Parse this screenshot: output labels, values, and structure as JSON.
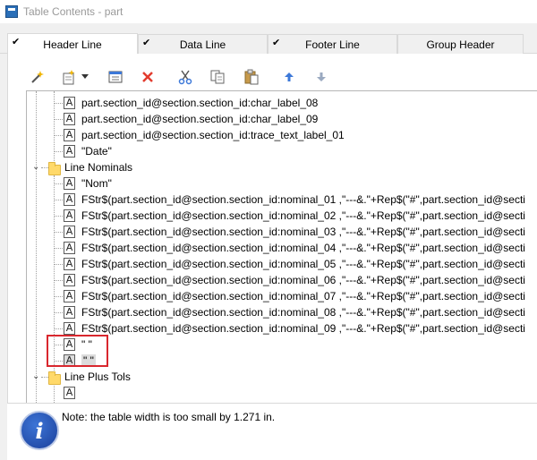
{
  "window": {
    "title": "Table Contents - part"
  },
  "tabs": [
    {
      "label": "Header Line",
      "checked": true,
      "active": true
    },
    {
      "label": "Data Line",
      "checked": true,
      "active": false
    },
    {
      "label": "Footer Line",
      "checked": true,
      "active": false
    },
    {
      "label": "Group Header",
      "checked": false,
      "active": false
    }
  ],
  "toolbar": {
    "icons": [
      "wand-icon",
      "new-item-icon",
      "dropdown-arrow-icon",
      "properties-icon",
      "delete-icon",
      "cut-icon",
      "copy-icon",
      "paste-icon",
      "move-up-icon",
      "move-down-icon"
    ]
  },
  "tree": {
    "items": [
      {
        "type": "text",
        "text": "part.section_id@section.section_id:char_label_08"
      },
      {
        "type": "text",
        "text": "part.section_id@section.section_id:char_label_09"
      },
      {
        "type": "text",
        "text": "part.section_id@section.section_id:trace_text_label_01"
      },
      {
        "type": "text",
        "text": "\"Date\""
      },
      {
        "type": "folder",
        "text": "Line Nominals",
        "expanded": true
      },
      {
        "type": "text",
        "text": "\"Nom\""
      },
      {
        "type": "text",
        "text": "FStr$(part.section_id@section.section_id:nominal_01 ,\"---&.\"+Rep$(\"#\",part.section_id@secti"
      },
      {
        "type": "text",
        "text": "FStr$(part.section_id@section.section_id:nominal_02 ,\"---&.\"+Rep$(\"#\",part.section_id@secti"
      },
      {
        "type": "text",
        "text": "FStr$(part.section_id@section.section_id:nominal_03 ,\"---&.\"+Rep$(\"#\",part.section_id@secti"
      },
      {
        "type": "text",
        "text": "FStr$(part.section_id@section.section_id:nominal_04 ,\"---&.\"+Rep$(\"#\",part.section_id@secti"
      },
      {
        "type": "text",
        "text": "FStr$(part.section_id@section.section_id:nominal_05 ,\"---&.\"+Rep$(\"#\",part.section_id@secti"
      },
      {
        "type": "text",
        "text": "FStr$(part.section_id@section.section_id:nominal_06 ,\"---&.\"+Rep$(\"#\",part.section_id@secti"
      },
      {
        "type": "text",
        "text": "FStr$(part.section_id@section.section_id:nominal_07 ,\"---&.\"+Rep$(\"#\",part.section_id@secti"
      },
      {
        "type": "text",
        "text": "FStr$(part.section_id@section.section_id:nominal_08 ,\"---&.\"+Rep$(\"#\",part.section_id@secti"
      },
      {
        "type": "text",
        "text": "FStr$(part.section_id@section.section_id:nominal_09 ,\"---&.\"+Rep$(\"#\",part.section_id@secti"
      },
      {
        "type": "text",
        "text": "\" \""
      },
      {
        "type": "text",
        "text": "\" \"",
        "selected": true
      },
      {
        "type": "folder",
        "text": "Line Plus Tols",
        "expanded": true
      }
    ]
  },
  "status": {
    "note": "Note: the table width is too small by 1.271 in."
  },
  "colors": {
    "highlight_box": "#d9272e",
    "folder": "#ffd96a",
    "delete": "#e23b2e",
    "arrow": "#3c78d8"
  }
}
